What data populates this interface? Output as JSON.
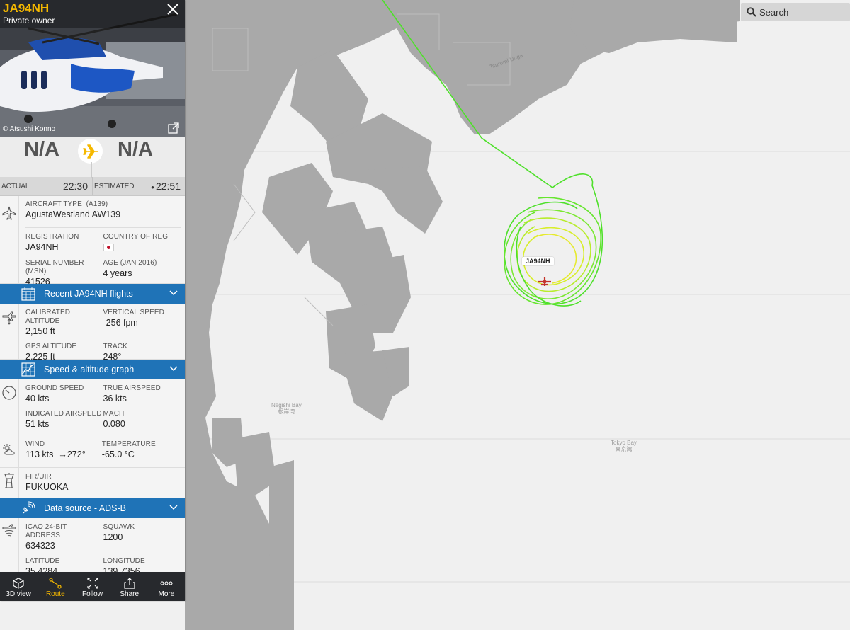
{
  "flight": {
    "callsign": "JA94NH",
    "owner": "Private owner",
    "photo_credit": "© Atsushi Konno",
    "origin": "N/A",
    "destination": "N/A"
  },
  "times": {
    "actual_label": "ACTUAL",
    "actual_value": "22:30",
    "estimated_label": "ESTIMATED",
    "estimated_value": "22:51"
  },
  "aircraft": {
    "type_label": "AIRCRAFT TYPE",
    "type_code": "(A139)",
    "type_value": "AgustaWestland AW139",
    "registration_label": "REGISTRATION",
    "registration_value": "JA94NH",
    "country_label": "COUNTRY OF REG.",
    "msn_label": "SERIAL NUMBER (MSN)",
    "msn_value": "41526",
    "age_label": "AGE (JAN 2016)",
    "age_value": "4 years"
  },
  "recent_flights_bar": "Recent JA94NH flights",
  "altitude": {
    "cal_alt_label": "CALIBRATED ALTITUDE",
    "cal_alt_value": "2,150 ft",
    "vspeed_label": "VERTICAL SPEED",
    "vspeed_value": "-256 fpm",
    "gps_alt_label": "GPS ALTITUDE",
    "gps_alt_value": "2,225 ft",
    "track_label": "TRACK",
    "track_value": "248°"
  },
  "speed_graph_bar": "Speed & altitude graph",
  "speed": {
    "gs_label": "GROUND SPEED",
    "gs_value": "40 kts",
    "tas_label": "TRUE AIRSPEED",
    "tas_value": "36 kts",
    "ias_label": "INDICATED AIRSPEED",
    "ias_value": "51 kts",
    "mach_label": "MACH",
    "mach_value": "0.080"
  },
  "weather": {
    "wind_label": "WIND",
    "wind_speed": "113 kts",
    "wind_dir": "272°",
    "temp_label": "TEMPERATURE",
    "temp_value": "-65.0 °C"
  },
  "fir": {
    "label": "FIR/UIR",
    "value": "FUKUOKA"
  },
  "data_source_bar": "Data source - ADS-B",
  "datasource": {
    "icao_label": "ICAO 24-BIT ADDRESS",
    "icao_value": "634323",
    "squawk_label": "SQUAWK",
    "squawk_value": "1200",
    "lat_label": "LATITUDE",
    "lat_value": "35.4284",
    "lon_label": "LONGITUDE",
    "lon_value": "139.7356"
  },
  "nav": {
    "view3d": "3D view",
    "route": "Route",
    "follow": "Follow",
    "share": "Share",
    "more": "More"
  },
  "search": {
    "placeholder": "Search"
  },
  "map": {
    "aircraft_label": "JA94NH",
    "negishi_en": "Negishi Bay",
    "negishi_jp": "根岸湾",
    "tokyo_en": "Tokyo Bay",
    "tokyo_jp": "東京湾",
    "canal": "Tsurumi Unga"
  },
  "colors": {
    "accent": "#f5b800",
    "bar_blue": "#1f73b7",
    "land": "#a9a9a9",
    "water": "#f0f0f0",
    "track_green": "#4ee02a",
    "track_yellow": "#d8ee2a"
  }
}
